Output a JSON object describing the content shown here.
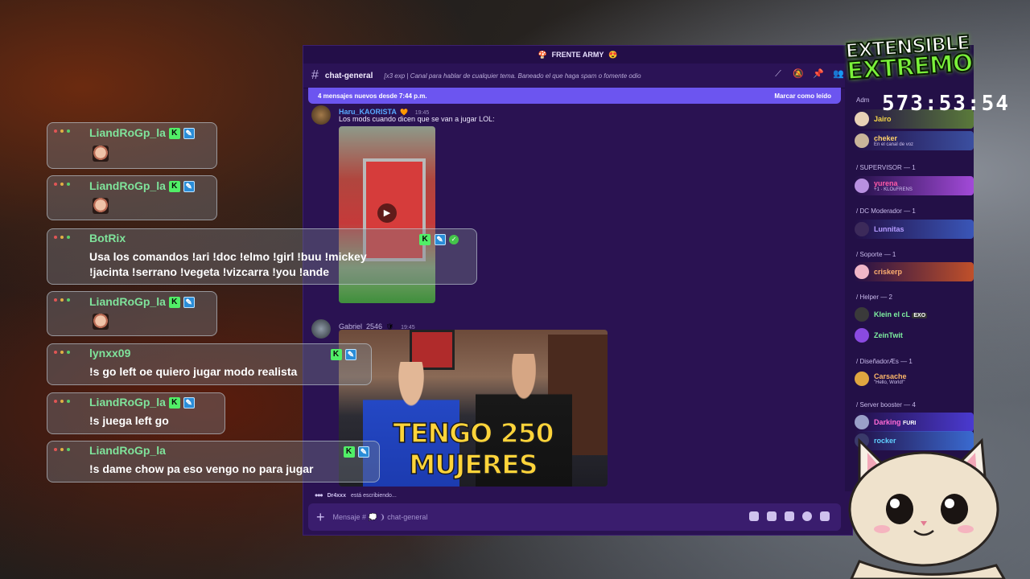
{
  "discord": {
    "server_name": "FRENTE ARMY",
    "channel": "chat-general",
    "topic": "[x3 exp | Canal para hablar de cualquier tema. Baneado el que haga spam o fomente odio.",
    "banner_left": "4 mensajes nuevos desde 7:44 p.m.",
    "banner_right": "Marcar como leído",
    "msg1": {
      "author": "Haru_KAORISTA",
      "time": "19:45",
      "text": "Los mods cuando dicen que se van a jugar LOL:"
    },
    "msg2": {
      "author": "Gabriel_2546",
      "time": "19:45",
      "caption": "TENGO 250 MUJERES"
    },
    "typing_user": "Dr4xxx",
    "typing_suffix": "está escribiendo...",
    "composer_placeholder": "Mensaje # 💭 ❩ chat-general"
  },
  "members": {
    "groups": [
      {
        "label": "Adm"
      },
      {
        "label": "/ SUPERVISOR — 1"
      },
      {
        "label": "/ DC Moderador — 1"
      },
      {
        "label": "/ Soporte — 1"
      },
      {
        "label": "/ Helper — 2"
      },
      {
        "label": "/ DiseñadorÆs — 1"
      },
      {
        "label": "/ Server booster — 4"
      }
    ],
    "people": [
      {
        "name": "Jairo",
        "sub": ""
      },
      {
        "name": "cheker",
        "sub": "En el canal de voz"
      },
      {
        "name": "yurena",
        "sub": "+1 · KLOuFRENS"
      },
      {
        "name": "Lunnitas",
        "sub": ""
      },
      {
        "name": "criskerp",
        "sub": ""
      },
      {
        "name": "Klein el cL",
        "sub": "EXO"
      },
      {
        "name": "ZeinTwit",
        "sub": ""
      },
      {
        "name": "Carsache",
        "sub": "\"Hello, World!\""
      },
      {
        "name": "Darking",
        "sub": "FURI"
      },
      {
        "name": "rocker",
        "sub": ""
      }
    ]
  },
  "overlay": {
    "messages": [
      {
        "user": "LiandRoGp_la",
        "text": ""
      },
      {
        "user": "LiandRoGp_la",
        "text": ""
      },
      {
        "user": "BotRix",
        "text": "Usa los comandos !ari !doc !elmo !girl !buu !mickey",
        "text2": "!jacinta !serrano !vegeta !vizcarra !you !ande"
      },
      {
        "user": "LiandRoGp_la",
        "text": ""
      },
      {
        "user": "lynxx09",
        "text": "!s go left oe quiero jugar modo realista"
      },
      {
        "user": "LiandRoGp_la",
        "text": "!s juega left go"
      },
      {
        "user": "LiandRoGp_la",
        "text": "!s dame chow pa eso vengo no para jugar"
      }
    ],
    "badge_k": "K",
    "badge_h": "✎"
  },
  "stream": {
    "logo_line1": "EXTENSIBLE",
    "logo_line2": "EXTREMO",
    "timer": "573:53:54"
  },
  "colors": {
    "accent": "#6c55f0",
    "discord_bg": "#2a1252",
    "overlay_name": "#7fe39b"
  }
}
